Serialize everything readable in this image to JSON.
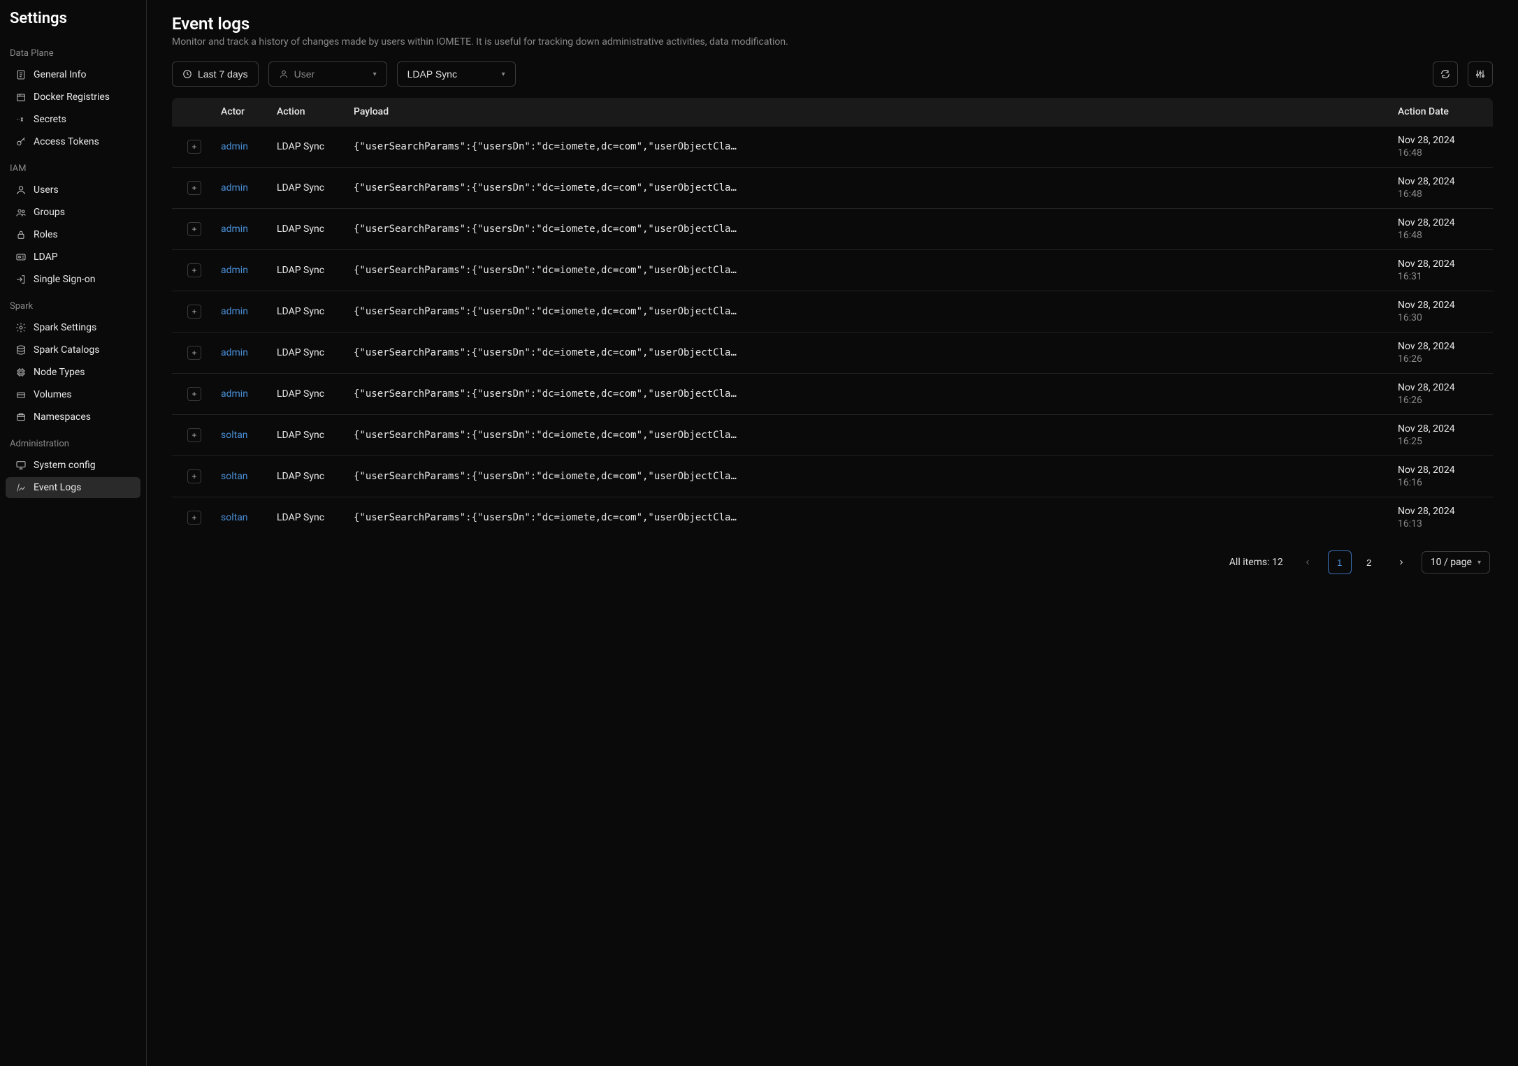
{
  "sidebar": {
    "title": "Settings",
    "sections": [
      {
        "label": "Data Plane",
        "items": [
          {
            "label": "General Info",
            "icon": "file-icon"
          },
          {
            "label": "Docker Registries",
            "icon": "box-icon"
          },
          {
            "label": "Secrets",
            "icon": "secret-icon"
          },
          {
            "label": "Access Tokens",
            "icon": "key-icon"
          }
        ]
      },
      {
        "label": "IAM",
        "items": [
          {
            "label": "Users",
            "icon": "user-icon"
          },
          {
            "label": "Groups",
            "icon": "group-icon"
          },
          {
            "label": "Roles",
            "icon": "lock-icon"
          },
          {
            "label": "LDAP",
            "icon": "id-icon"
          },
          {
            "label": "Single Sign-on",
            "icon": "login-icon"
          }
        ]
      },
      {
        "label": "Spark",
        "items": [
          {
            "label": "Spark Settings",
            "icon": "gear-icon"
          },
          {
            "label": "Spark Catalogs",
            "icon": "database-icon"
          },
          {
            "label": "Node Types",
            "icon": "cpu-icon"
          },
          {
            "label": "Volumes",
            "icon": "volume-icon"
          },
          {
            "label": "Namespaces",
            "icon": "namespace-icon"
          }
        ]
      },
      {
        "label": "Administration",
        "items": [
          {
            "label": "System config",
            "icon": "monitor-icon"
          },
          {
            "label": "Event Logs",
            "icon": "log-icon",
            "active": true
          }
        ]
      }
    ]
  },
  "page": {
    "title": "Event logs",
    "description": "Monitor and track a history of changes made by users within IOMETE. It is useful for tracking down administrative activities, data modification."
  },
  "filters": {
    "dateRange": "Last 7 days",
    "userPlaceholder": "User",
    "eventType": "LDAP Sync"
  },
  "table": {
    "headers": {
      "actor": "Actor",
      "action": "Action",
      "payload": "Payload",
      "date": "Action Date"
    },
    "rows": [
      {
        "actor": "admin",
        "action": "LDAP Sync",
        "payload": "{\"userSearchParams\":{\"usersDn\":\"dc=iomete,dc=com\",\"userObjectCla…",
        "date": "Nov 28, 2024",
        "time": "16:48"
      },
      {
        "actor": "admin",
        "action": "LDAP Sync",
        "payload": "{\"userSearchParams\":{\"usersDn\":\"dc=iomete,dc=com\",\"userObjectCla…",
        "date": "Nov 28, 2024",
        "time": "16:48"
      },
      {
        "actor": "admin",
        "action": "LDAP Sync",
        "payload": "{\"userSearchParams\":{\"usersDn\":\"dc=iomete,dc=com\",\"userObjectCla…",
        "date": "Nov 28, 2024",
        "time": "16:48"
      },
      {
        "actor": "admin",
        "action": "LDAP Sync",
        "payload": "{\"userSearchParams\":{\"usersDn\":\"dc=iomete,dc=com\",\"userObjectCla…",
        "date": "Nov 28, 2024",
        "time": "16:31"
      },
      {
        "actor": "admin",
        "action": "LDAP Sync",
        "payload": "{\"userSearchParams\":{\"usersDn\":\"dc=iomete,dc=com\",\"userObjectCla…",
        "date": "Nov 28, 2024",
        "time": "16:30"
      },
      {
        "actor": "admin",
        "action": "LDAP Sync",
        "payload": "{\"userSearchParams\":{\"usersDn\":\"dc=iomete,dc=com\",\"userObjectCla…",
        "date": "Nov 28, 2024",
        "time": "16:26"
      },
      {
        "actor": "admin",
        "action": "LDAP Sync",
        "payload": "{\"userSearchParams\":{\"usersDn\":\"dc=iomete,dc=com\",\"userObjectCla…",
        "date": "Nov 28, 2024",
        "time": "16:26"
      },
      {
        "actor": "soltan",
        "action": "LDAP Sync",
        "payload": "{\"userSearchParams\":{\"usersDn\":\"dc=iomete,dc=com\",\"userObjectCla…",
        "date": "Nov 28, 2024",
        "time": "16:25"
      },
      {
        "actor": "soltan",
        "action": "LDAP Sync",
        "payload": "{\"userSearchParams\":{\"usersDn\":\"dc=iomete,dc=com\",\"userObjectCla…",
        "date": "Nov 28, 2024",
        "time": "16:16"
      },
      {
        "actor": "soltan",
        "action": "LDAP Sync",
        "payload": "{\"userSearchParams\":{\"usersDn\":\"dc=iomete,dc=com\",\"userObjectCla…",
        "date": "Nov 28, 2024",
        "time": "16:13"
      }
    ]
  },
  "pagination": {
    "summary": "All items: 12",
    "pages": [
      "1",
      "2"
    ],
    "active": "1",
    "pageSize": "10 / page"
  }
}
